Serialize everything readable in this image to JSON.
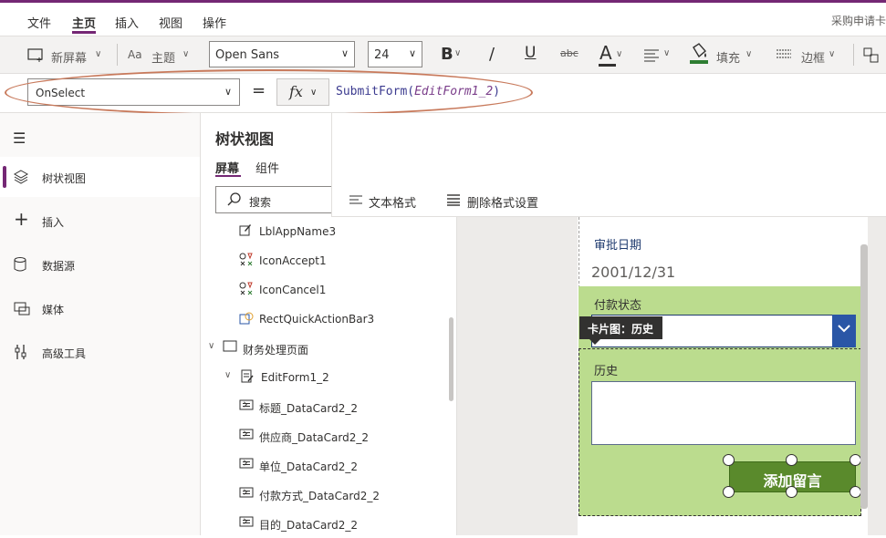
{
  "menu": {
    "items": [
      "文件",
      "主页",
      "插入",
      "视图",
      "操作"
    ],
    "active": "主页",
    "app_title": "采购申请卡"
  },
  "toolbar": {
    "new_screen": "新屏幕",
    "theme": "主题",
    "font": "Open Sans",
    "font_size": "24",
    "bold_glyph": "B",
    "italic_glyph": "/",
    "underline_glyph": "U",
    "strike_glyph": "abc",
    "font_color_glyph": "A",
    "fill": "填充",
    "border": "边框",
    "accent_color": "#742774",
    "fill_underline_color": "#2e7d32"
  },
  "formula": {
    "property": "OnSelect",
    "equals": "=",
    "fx": "fx",
    "func": "SubmitForm(",
    "arg": "EditForm1_2",
    "close": ")"
  },
  "leftnav": {
    "items": [
      {
        "label": "树状视图",
        "icon": "layers-icon",
        "active": true
      },
      {
        "label": "插入",
        "icon": "plus-icon",
        "active": false
      },
      {
        "label": "数据源",
        "icon": "database-icon",
        "active": false
      },
      {
        "label": "媒体",
        "icon": "media-icon",
        "active": false
      },
      {
        "label": "高级工具",
        "icon": "tools-icon",
        "active": false
      }
    ]
  },
  "tree": {
    "title": "树状视图",
    "tabs": [
      "屏幕",
      "组件"
    ],
    "search_placeholder": "搜索",
    "rows": [
      {
        "label": "LblAppName3",
        "icon": "label-edit-icon",
        "indent": 2,
        "chevron": ""
      },
      {
        "label": "IconAccept1",
        "icon": "icon-shapes-icon",
        "indent": 2,
        "chevron": ""
      },
      {
        "label": "IconCancel1",
        "icon": "icon-shapes-icon",
        "indent": 2,
        "chevron": ""
      },
      {
        "label": "RectQuickActionBar3",
        "icon": "shape-icon",
        "indent": 2,
        "chevron": ""
      },
      {
        "label": "财务处理页面",
        "icon": "screen-icon",
        "indent": 0,
        "chevron": "down"
      },
      {
        "label": "EditForm1_2",
        "icon": "form-icon",
        "indent": 1,
        "chevron": "down"
      },
      {
        "label": "标题_DataCard2_2",
        "icon": "card-icon",
        "indent": 2,
        "chevron": "right"
      },
      {
        "label": "供应商_DataCard2_2",
        "icon": "card-icon",
        "indent": 2,
        "chevron": "right"
      },
      {
        "label": "单位_DataCard2_2",
        "icon": "card-icon",
        "indent": 2,
        "chevron": "right"
      },
      {
        "label": "付款方式_DataCard2_2",
        "icon": "card-icon",
        "indent": 2,
        "chevron": "right"
      },
      {
        "label": "目的_DataCard2_2",
        "icon": "card-icon",
        "indent": 2,
        "chevron": "right"
      }
    ]
  },
  "format_bar": {
    "text_format": "文本格式",
    "clear_format": "删除格式设置"
  },
  "canvas": {
    "approval_date_label": "审批日期",
    "approval_date_value": "2001/12/31",
    "payment_status_label": "付款状态",
    "tooltip": "卡片图：历史",
    "history_label": "历史",
    "add_comment_button": "添加留言",
    "green_color": "#bbdc8e",
    "button_color": "#5a8a2c",
    "dropdown_button_color": "#2a56a6"
  }
}
